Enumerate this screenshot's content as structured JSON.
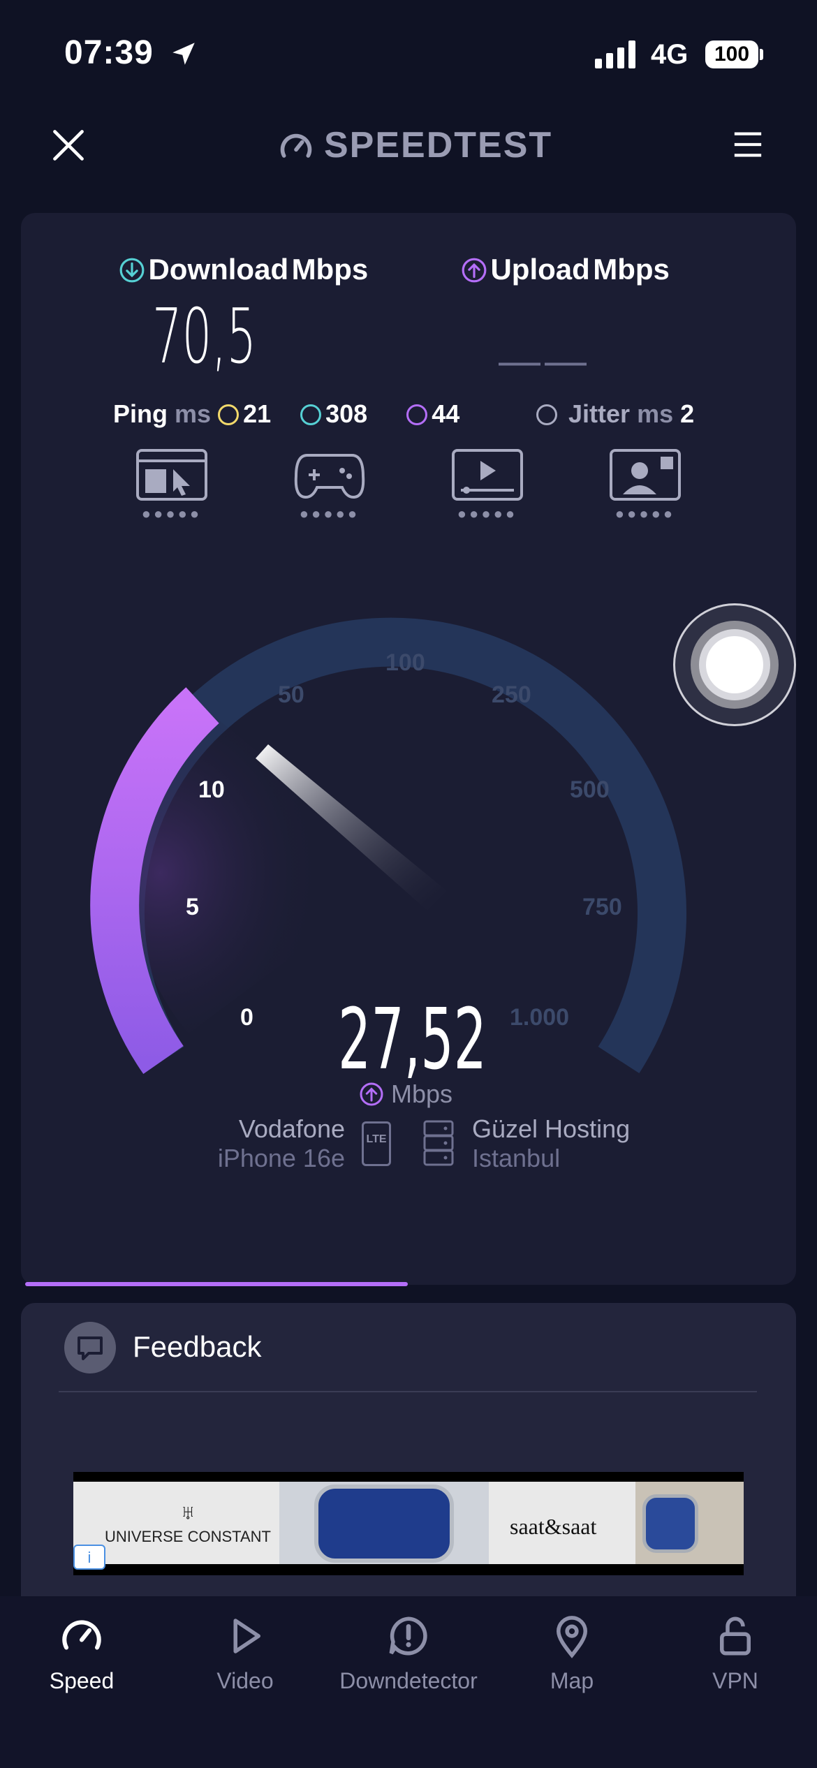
{
  "status_bar": {
    "time": "07:39",
    "network": "4G",
    "battery": "100"
  },
  "header": {
    "title": "SPEEDTEST"
  },
  "test": {
    "download_label": "Download",
    "upload_label": "Upload",
    "unit": "Mbps",
    "download_value": "70,5",
    "upload_value": "——",
    "ping_label": "Ping",
    "ping_unit": "ms",
    "ping_idle": "21",
    "ping_download": "308",
    "ping_upload": "44",
    "jitter_label": "Jitter",
    "jitter_unit": "ms",
    "jitter_value": "2"
  },
  "gauge": {
    "labels": [
      "0",
      "5",
      "10",
      "50",
      "100",
      "250",
      "500",
      "750",
      "1.000"
    ],
    "current_value": "27,52",
    "current_unit": "Mbps"
  },
  "connection": {
    "provider": "Vodafone",
    "device": "iPhone 16e",
    "network_badge": "LTE",
    "server_name": "Güzel Hosting",
    "server_location": "Istanbul"
  },
  "feedback": {
    "label": "Feedback"
  },
  "ad": {
    "brand_left": "UNIVERSE CONSTANT",
    "brand_right": "saat&saat",
    "info": "i"
  },
  "nav": [
    {
      "label": "Speed"
    },
    {
      "label": "Video"
    },
    {
      "label": "Downdetector"
    },
    {
      "label": "Map"
    },
    {
      "label": "VPN"
    }
  ],
  "colors": {
    "accent": "#b46ef8",
    "download": "#56d0d4",
    "idle_ping": "#f2d96b",
    "background": "#0f1224",
    "card": "#1b1d33"
  }
}
